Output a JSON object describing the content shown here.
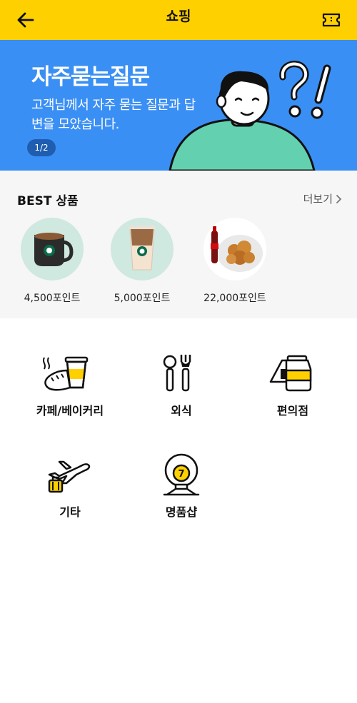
{
  "header": {
    "title": "쇼핑",
    "back_icon": "arrow-left-icon",
    "right_icon": "coupon-ticket-icon"
  },
  "banner": {
    "title": "자주묻는질문",
    "subtitle": "고객님께서 자주 묻는 질문과 답변을 모았습니다.",
    "page_indicator": "1/2",
    "background": "#3A8FF4"
  },
  "best": {
    "label": "BEST 상품",
    "more_label": "더보기",
    "products": [
      {
        "price": "4,500포인트",
        "image": "starbucks-hot-coffee-mug"
      },
      {
        "price": "5,000포인트",
        "image": "starbucks-iced-latte"
      },
      {
        "price": "22,000포인트",
        "image": "fried-chicken-and-cola"
      }
    ]
  },
  "categories": [
    {
      "label": "카페/베이커리",
      "icon": "coffee-cup-bread-icon"
    },
    {
      "label": "외식",
      "icon": "fork-spoon-icon"
    },
    {
      "label": "편의점",
      "icon": "convenience-store-food-icon"
    },
    {
      "label": "기타",
      "icon": "airplane-luggage-icon"
    },
    {
      "label": "명품샵",
      "icon": "lottery-ball-icon"
    }
  ],
  "colors": {
    "accent": "#FFD000",
    "banner": "#3A8FF4",
    "section_bg": "#F6F6F6"
  }
}
